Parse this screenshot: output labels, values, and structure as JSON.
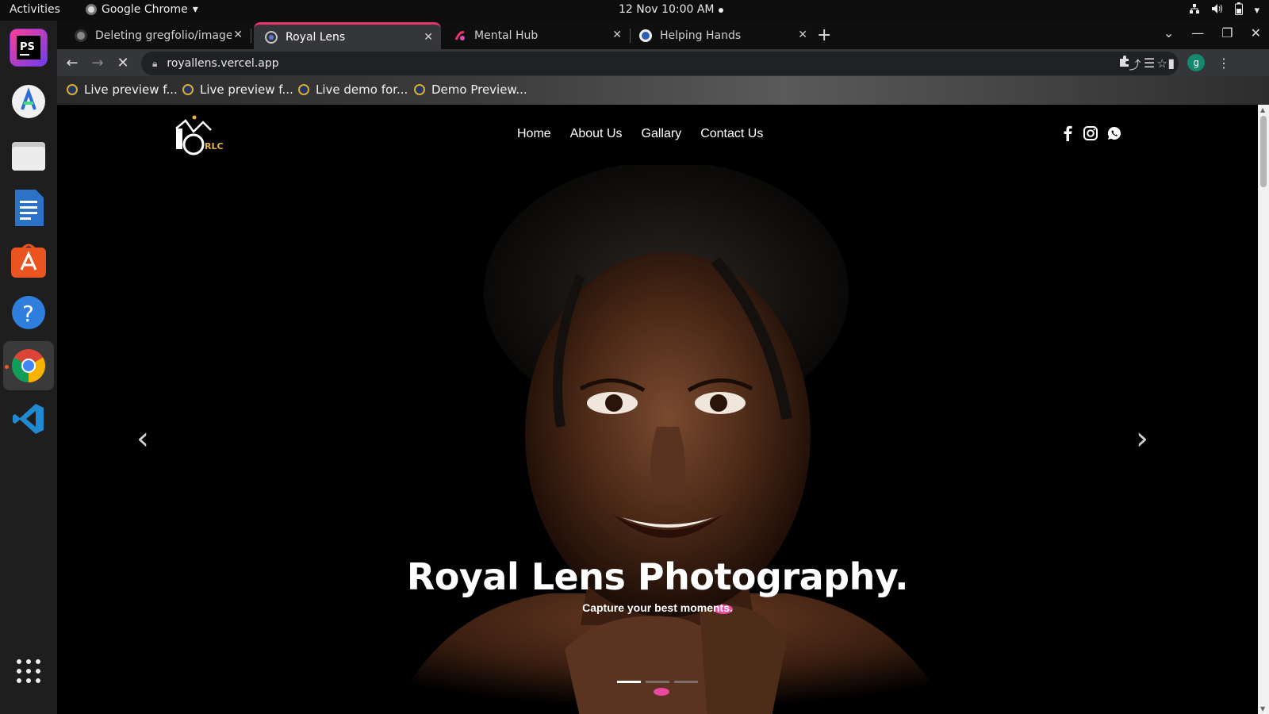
{
  "topbar": {
    "activities": "Activities",
    "app_name": "Google Chrome",
    "clock": "12 Nov  10:00 AM",
    "tray_icons": [
      "network-icon",
      "volume-icon",
      "battery-icon",
      "chevron-down-icon"
    ]
  },
  "dock": {
    "apps": [
      {
        "name": "PhpStorm",
        "icon": "phpstorm-icon",
        "label": "PS",
        "color": "#a43cd6"
      },
      {
        "name": "Android Studio",
        "icon": "android-studio-icon",
        "color": "#2d6bd8"
      },
      {
        "name": "Files",
        "icon": "files-icon",
        "color": "#e5e5e5"
      },
      {
        "name": "LibreOffice Writer",
        "icon": "writer-icon",
        "color": "#2a73c9"
      },
      {
        "name": "Ubuntu Software",
        "icon": "software-icon",
        "color": "#e95420"
      },
      {
        "name": "Help",
        "icon": "help-icon",
        "label": "?",
        "color": "#2e7fde"
      },
      {
        "name": "Google Chrome",
        "icon": "chrome-icon",
        "color": "#db4437"
      },
      {
        "name": "Visual Studio Code",
        "icon": "vscode-icon",
        "color": "#1f8ad2"
      }
    ],
    "show_apps_icon": "grid-icon"
  },
  "browser": {
    "tabs": [
      {
        "title": "Deleting gregfolio/image",
        "favicon": "github-icon",
        "active": false
      },
      {
        "title": "Royal Lens",
        "favicon": "royal-lens-icon",
        "active": true
      },
      {
        "title": "Mental Hub",
        "favicon": "mental-hub-icon",
        "active": false
      },
      {
        "title": "Helping Hands",
        "favicon": "helping-hands-icon",
        "active": false
      }
    ],
    "url": "royallens.vercel.app",
    "bookmarks": [
      "Live preview f...",
      "Live preview f...",
      "Live demo for...",
      "Demo Preview..."
    ],
    "avatar_letter": "g",
    "avatar_color": "#138a6e",
    "accent_color": "#e8336b"
  },
  "site": {
    "logo_text": "RLC",
    "nav": [
      "Home",
      "About Us",
      "Gallary",
      "Contact Us"
    ],
    "social_icons": [
      "facebook-icon",
      "instagram-icon",
      "whatsapp-icon"
    ],
    "hero": {
      "title": "Royal Lens Photography.",
      "subtitle": "Capture your best moments.",
      "slides_count": 3,
      "active_slide": 0
    }
  }
}
